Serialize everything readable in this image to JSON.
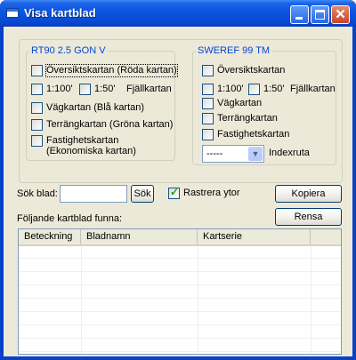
{
  "window": {
    "title": "Visa kartblad"
  },
  "titlebar_buttons": {
    "close_glyph": "✕"
  },
  "rt90": {
    "legend": "RT90 2.5 GON V",
    "items": [
      {
        "label": "Översiktskartan (Röda kartan)",
        "checked": false
      },
      {
        "label": "1:100'",
        "checked": false
      },
      {
        "label": "1:50'",
        "checked": false
      },
      {
        "label": "Fjällkartan"
      },
      {
        "label": "Vägkartan (Blå kartan)",
        "checked": false
      },
      {
        "label": "Terrängkartan (Gröna kartan)",
        "checked": false
      },
      {
        "label": "Fastighetskartan (Ekonomiska kartan)",
        "checked": false
      }
    ]
  },
  "sweref": {
    "legend": "SWEREF 99 TM",
    "items": [
      {
        "label": "Översiktskartan",
        "checked": false
      },
      {
        "label": "1:100'",
        "checked": false
      },
      {
        "label": "1:50'",
        "checked": false
      },
      {
        "label": "Fjällkartan"
      },
      {
        "label": "Vägkartan",
        "checked": false
      },
      {
        "label": "Terrängkartan",
        "checked": false
      },
      {
        "label": "Fastighetskartan",
        "checked": false
      }
    ],
    "index_select_value": "-----",
    "index_label": "Indexruta"
  },
  "search": {
    "label": "Sök blad:",
    "value": "",
    "button": "Sök",
    "rastrera_label": "Rastrera ytor",
    "rastrera_checked": true
  },
  "actions": {
    "kopiera": "Kopiera",
    "rensa": "Rensa"
  },
  "results": {
    "label": "Följande kartblad funna:",
    "columns": [
      "Beteckning",
      "Bladnamn",
      "Kartserie"
    ],
    "rows": []
  },
  "colors": {
    "titlebar": "#0a55e0",
    "client": "#ece9d8",
    "legend_text": "#0046d5"
  }
}
